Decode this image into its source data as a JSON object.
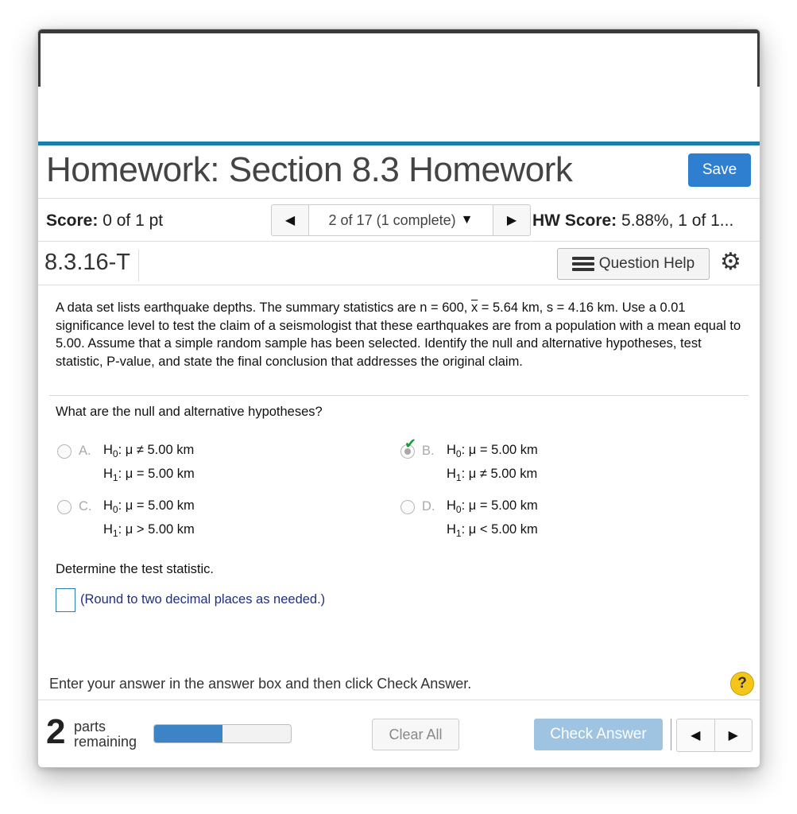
{
  "header": {
    "title": "Homework: Section 8.3 Homework",
    "save_label": "Save"
  },
  "score_bar": {
    "score_label": "Score:",
    "score_value": "0 of 1 pt",
    "nav_position": "2 of 17 (1 complete)",
    "hw_score_label": "HW Score:",
    "hw_score_value": "5.88%, 1 of 1..."
  },
  "question_bar": {
    "question_id": "8.3.16-T",
    "help_label": "Question Help"
  },
  "question": {
    "text_before_xbar": "A data set lists earthquake depths. The summary statistics are n = 600, ",
    "xbar_symbol": "x",
    "text_after_xbar": " = 5.64 km, s = 4.16 km. Use a 0.01 significance level to test the claim of a seismologist that these earthquakes are from a population with a mean equal to 5.00. Assume that a simple random sample has been selected. Identify the null and alternative hypotheses, test statistic, P-value, and state the final conclusion that addresses the original claim.",
    "prompt_hypotheses": "What are the null and alternative hypotheses?",
    "options": [
      {
        "letter": "A.",
        "h0": "H",
        "h0_sub": "0",
        "h0_rest": ": μ ≠ 5.00 km",
        "h1": "H",
        "h1_sub": "1",
        "h1_rest": ": μ = 5.00 km",
        "selected": false
      },
      {
        "letter": "B.",
        "h0": "H",
        "h0_sub": "0",
        "h0_rest": ": μ = 5.00 km",
        "h1": "H",
        "h1_sub": "1",
        "h1_rest": ": μ ≠ 5.00 km",
        "selected": true
      },
      {
        "letter": "C.",
        "h0": "H",
        "h0_sub": "0",
        "h0_rest": ": μ = 5.00 km",
        "h1": "H",
        "h1_sub": "1",
        "h1_rest": ": μ > 5.00 km",
        "selected": false
      },
      {
        "letter": "D.",
        "h0": "H",
        "h0_sub": "0",
        "h0_rest": ": μ = 5.00 km",
        "h1": "H",
        "h1_sub": "1",
        "h1_rest": ": μ < 5.00 km",
        "selected": false
      }
    ],
    "prompt_statistic": "Determine the test statistic.",
    "answer_value": "",
    "round_hint": "(Round to two decimal places as needed.)"
  },
  "instruction": "Enter your answer in the answer box and then click Check Answer.",
  "help_symbol": "?",
  "footer": {
    "parts_count": "2",
    "parts_line1": "parts",
    "parts_line2": "remaining",
    "progress_fraction": 0.5,
    "clear_label": "Clear All",
    "check_label": "Check Answer"
  },
  "icons": {
    "prev": "◀",
    "next": "▶",
    "caret": "▼",
    "gear": "⚙",
    "check": "✔"
  },
  "colors": {
    "accent": "#1a7fa6",
    "save_button": "#2f7fd1",
    "check_button_disabled": "#9ec4e2",
    "progress_fill": "#3c84c6",
    "hint_text": "#1f2f82",
    "help_circle": "#f5c518"
  }
}
